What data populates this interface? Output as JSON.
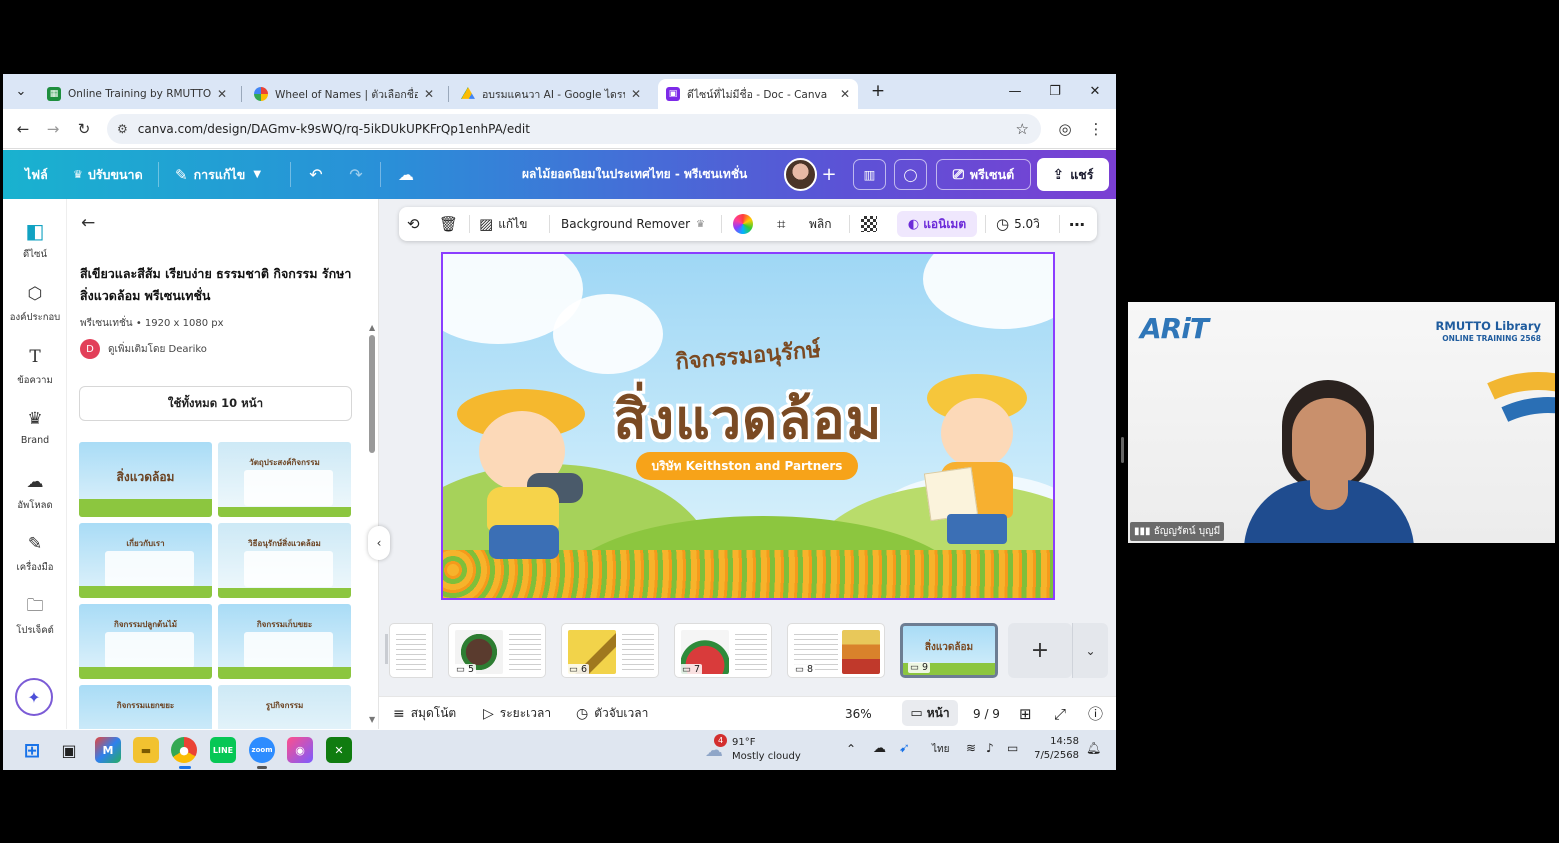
{
  "browser": {
    "tabs": [
      {
        "title": "Online Training by RMUTTO Lib",
        "icon_color": "#1e8e3e",
        "active": false
      },
      {
        "title": "Wheel of Names | ตัวเลือกชื่อแบบ",
        "icon_color": "#ea4335",
        "active": false
      },
      {
        "title": "อบรมแคนวา AI - Google ไดรฟ์",
        "icon_color": "#fbbc04",
        "active": false
      },
      {
        "title": "ดีไซน์ที่ไม่มีชื่อ - Doc - Canva",
        "icon_color": "#7d2ae8",
        "active": true
      }
    ],
    "url": "canva.com/design/DAGmv-k9sWQ/rq-5ikDUkUPKFrQp1enhPA/edit"
  },
  "canva_header": {
    "file_label": "ไฟล์",
    "resize_label": "ปรับขนาด",
    "edit_label": "การแก้ไข",
    "doc_title": "ผลไม้ยอดนิยมในประเทศไทย - พรีเซนเทชั่น",
    "present_label": "พรีเซนต์",
    "share_label": "แชร์"
  },
  "rail": [
    {
      "label": "ดีไซน์",
      "icon": "design-icon"
    },
    {
      "label": "องค์ประกอบ",
      "icon": "elements-icon"
    },
    {
      "label": "ข้อความ",
      "icon": "text-icon"
    },
    {
      "label": "Brand",
      "icon": "brand-icon"
    },
    {
      "label": "อัพโหลด",
      "icon": "upload-icon"
    },
    {
      "label": "เครื่องมือ",
      "icon": "tools-icon"
    },
    {
      "label": "โปรเจ็คต์",
      "icon": "projects-icon"
    }
  ],
  "panel": {
    "title": "สีเขียวและสีส้ม เรียบง่าย ธรรมชาติ กิจกรรม รักษาสิ่งแวดล้อม พรีเซนเทชั่น",
    "meta": "พรีเซนเทชั่น • 1920 x 1080 px",
    "author_initial": "D",
    "author": "ดูเพิ่มเติมโดย Deariko",
    "use_all": "ใช้ทั้งหมด 10 หน้า",
    "thumbs": [
      {
        "title": "สิ่งแวดล้อม"
      },
      {
        "title": "วัตถุประสงค์กิจกรรม"
      },
      {
        "title": "เกี่ยวกับเรา"
      },
      {
        "title": "วิธีอนุรักษ์สิ่งแวดล้อม"
      },
      {
        "title": "กิจกรรมปลูกต้นไม้"
      },
      {
        "title": "กิจกรรมเก็บขยะ"
      },
      {
        "title": "กิจกรรมแยกขยะ"
      },
      {
        "title": "รูปกิจกรรม"
      }
    ]
  },
  "context_toolbar": {
    "edit_label": "แก้ไข",
    "bg_remover": "Background Remover",
    "flip_label": "พลิก",
    "animate_label": "แอนิเมต",
    "duration": "5.0วิ"
  },
  "slide": {
    "subtitle": "กิจกรรมอนุรักษ์",
    "title": "สิ่งแวดล้อม",
    "company": "บริษัท Keithston and Partners"
  },
  "filmstrip": {
    "pages": [
      {
        "num": "5",
        "color": "#6b4a3a"
      },
      {
        "num": "6",
        "color": "#e9c23b"
      },
      {
        "num": "7",
        "color": "#c0392b"
      },
      {
        "num": "8",
        "color": "#d9822b"
      },
      {
        "num": "9",
        "color": "#a9dcf6"
      }
    ]
  },
  "footer": {
    "notes": "สมุดโน้ต",
    "timeline": "ระยะเวลา",
    "timer": "ตัวจับเวลา",
    "zoom": "36%",
    "pages_btn": "หน้า",
    "page_count": "9 / 9"
  },
  "taskbar": {
    "weather_temp": "91°F",
    "weather_desc": "Mostly cloudy",
    "weather_badge": "4",
    "lang": "ไทย",
    "time": "14:58",
    "date": "7/5/2568"
  },
  "webcam": {
    "logo": "ARiT",
    "library": "RMUTTO Library",
    "subtitle": "ONLINE TRAINING 2568",
    "name": "ธัญญรัตน์ บุญมี"
  },
  "colors": {
    "accent": "#8b3dff",
    "header_start": "#19b2cf",
    "header_end": "#7a3fd3"
  }
}
